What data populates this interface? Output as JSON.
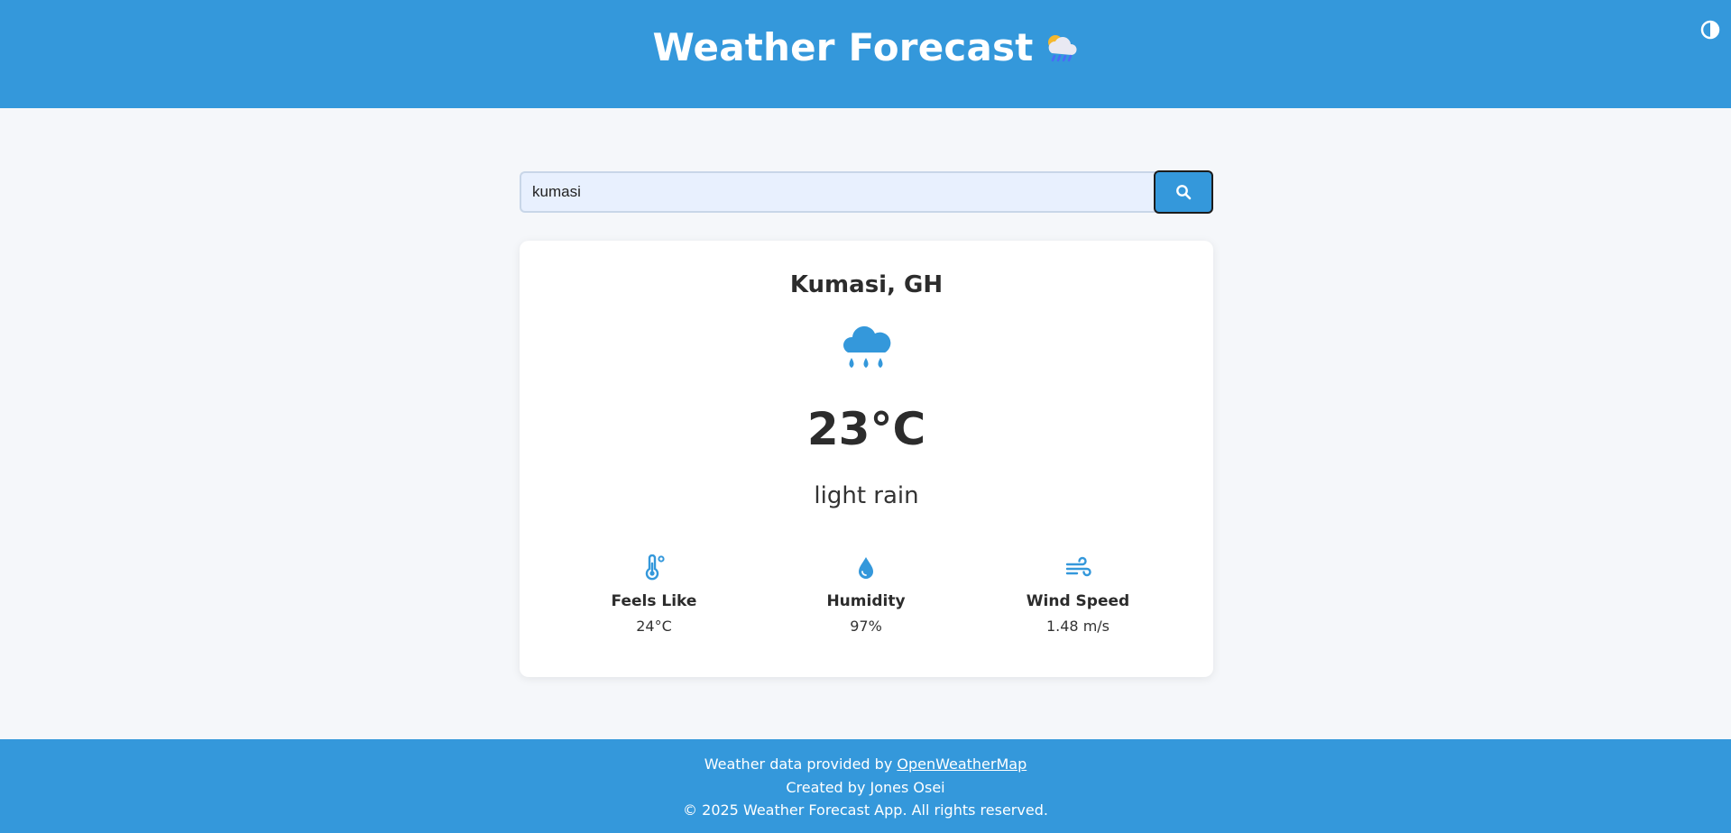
{
  "header": {
    "title": "Weather Forecast",
    "title_emoji": "cloud-with-rain-emoji",
    "theme_toggle_icon": "contrast-icon"
  },
  "search": {
    "value": "kumasi",
    "placeholder": "",
    "button_icon": "search-icon"
  },
  "weather": {
    "city": "Kumasi, GH",
    "icon": "rain-cloud-icon",
    "temperature": "23°C",
    "description": "light rain",
    "details": [
      {
        "icon": "thermometer-icon",
        "label": "Feels Like",
        "value": "24°C"
      },
      {
        "icon": "droplet-icon",
        "label": "Humidity",
        "value": "97%"
      },
      {
        "icon": "wind-icon",
        "label": "Wind Speed",
        "value": "1.48 m/s"
      }
    ]
  },
  "footer": {
    "provided_by_prefix": "Weather data provided by ",
    "provider_link": "OpenWeatherMap",
    "created_by": "Created by Jones Osei",
    "copyright": "© 2025 Weather Forecast App. All rights reserved."
  },
  "colors": {
    "accent": "#3498db",
    "page_background": "#f5f7fa",
    "input_background": "#e8f0fe",
    "card_background": "#ffffff",
    "text_dark": "#2c2c2c"
  }
}
